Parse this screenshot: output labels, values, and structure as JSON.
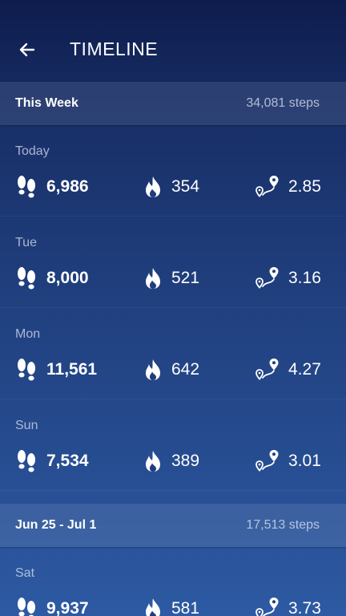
{
  "header": {
    "title": "TIMELINE",
    "back_icon": "arrow-left-icon"
  },
  "icons": {
    "steps": "footprints-icon",
    "calories": "flame-icon",
    "distance": "route-pin-icon"
  },
  "weeks": [
    {
      "label": "This Week",
      "total": "34,081 steps",
      "days": [
        {
          "day": "Today",
          "steps": "6,986",
          "calories": "354",
          "distance": "2.85"
        },
        {
          "day": "Tue",
          "steps": "8,000",
          "calories": "521",
          "distance": "3.16"
        },
        {
          "day": "Mon",
          "steps": "11,561",
          "calories": "642",
          "distance": "4.27"
        },
        {
          "day": "Sun",
          "steps": "7,534",
          "calories": "389",
          "distance": "3.01"
        }
      ]
    },
    {
      "label": "Jun 25 - Jul 1",
      "total": "17,513 steps",
      "days": [
        {
          "day": "Sat",
          "steps": "9,937",
          "calories": "581",
          "distance": "3.73"
        }
      ]
    }
  ],
  "colors": {
    "background_top": "#132458",
    "background_bottom": "#2d5aa3",
    "appbar": "#0e1c4d",
    "text_primary": "#ffffff"
  }
}
